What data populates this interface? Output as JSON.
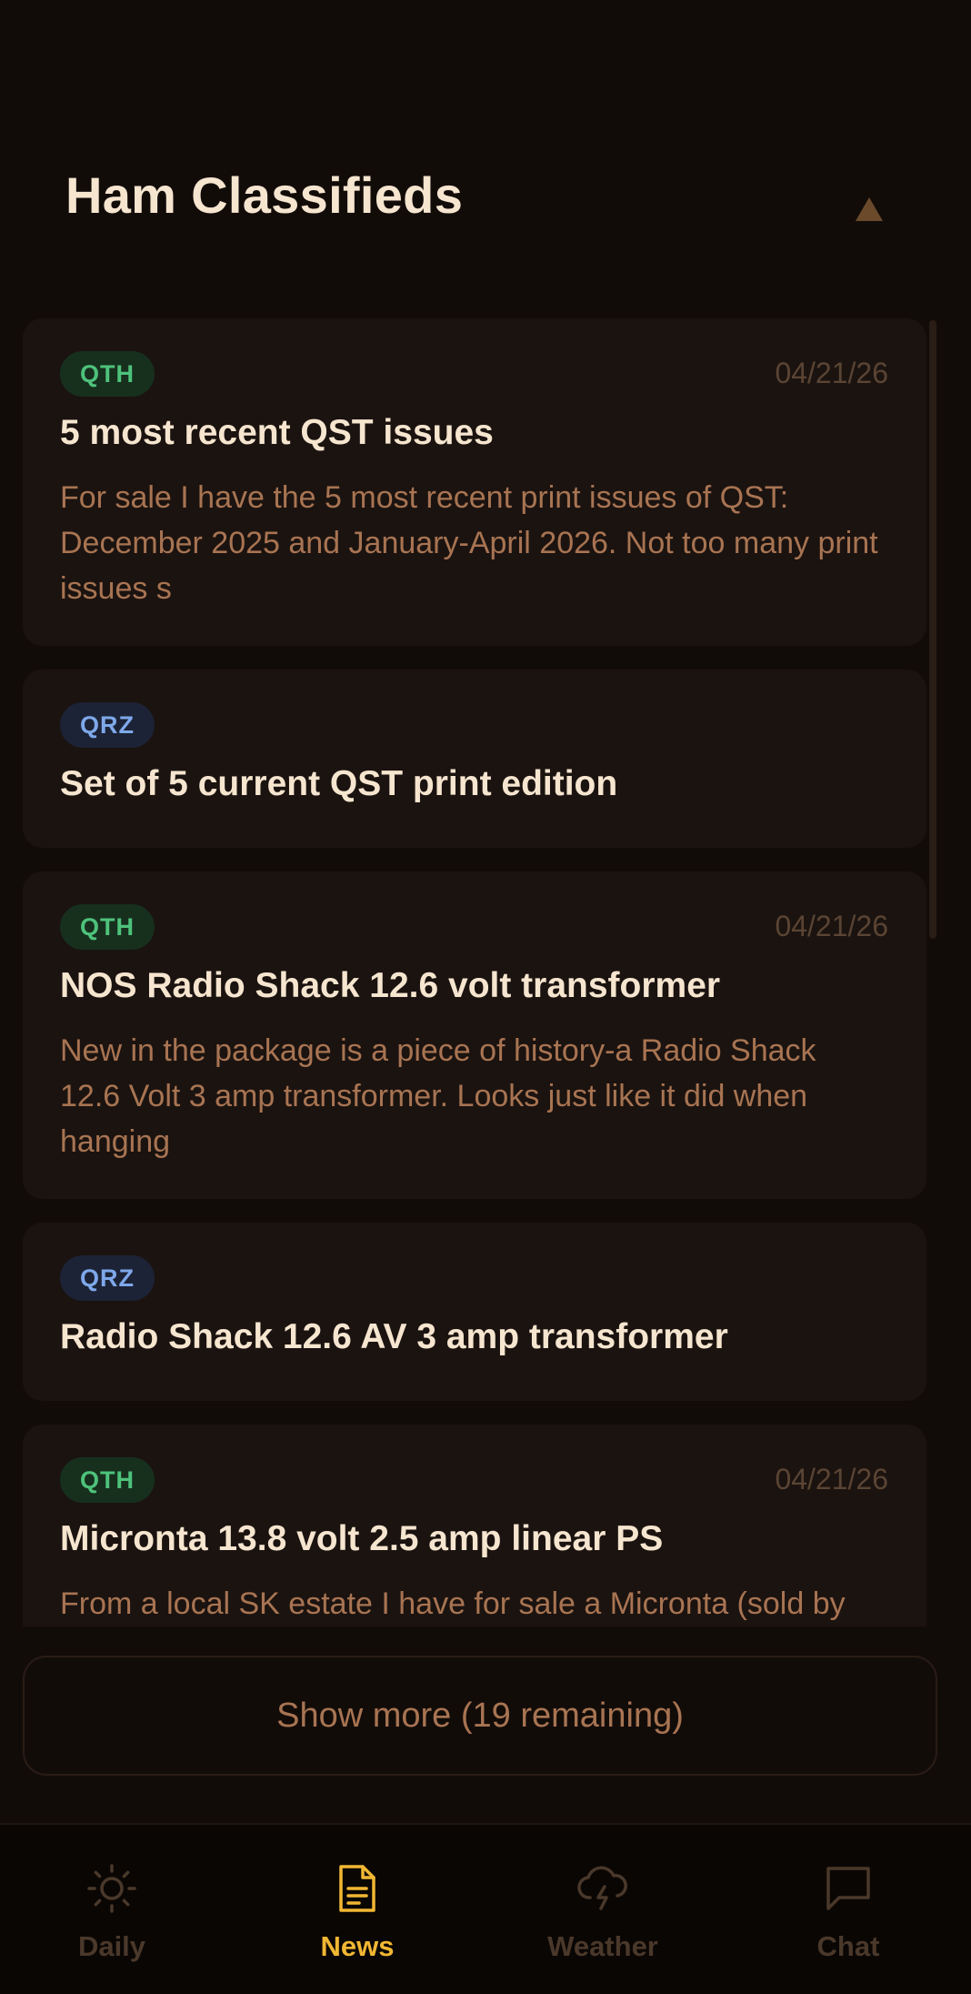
{
  "header": {
    "title": "Ham Classifieds",
    "collapse_icon": "triangle-up-icon"
  },
  "colors": {
    "background": "#120c09",
    "card": "#1b1310",
    "accent": "#f1b733",
    "title_text": "#f6e5cf",
    "snippet_text": "#a87452",
    "qth_badge": "#4ec27b",
    "qrz_badge": "#7ea8ea"
  },
  "listings": [
    {
      "source": "QTH",
      "date": "04/21/26",
      "title": "5 most recent QST issues",
      "snippet": "For sale I have the 5 most recent print issues of QST: December 2025 and January-April 2026. Not too many print issues s"
    },
    {
      "source": "QRZ",
      "date": "",
      "title": "Set of 5 current QST print edition",
      "snippet": ""
    },
    {
      "source": "QTH",
      "date": "04/21/26",
      "title": "NOS Radio Shack 12.6 volt transformer",
      "snippet": "New in the package is a piece of history-a Radio Shack 12.6 Volt 3 amp transformer. Looks just like it did when hanging"
    },
    {
      "source": "QRZ",
      "date": "",
      "title": "Radio Shack 12.6 AV 3 amp transformer",
      "snippet": ""
    },
    {
      "source": "QTH",
      "date": "04/21/26",
      "title": "Micronta 13.8 volt 2.5 amp linear PS",
      "snippet": "From a local SK estate I have for sale a Micronta (sold by"
    }
  ],
  "show_more": {
    "label": "Show more (19 remaining)"
  },
  "tabbar": {
    "active": "News",
    "tabs": [
      {
        "label": "Daily",
        "icon": "sun-icon"
      },
      {
        "label": "News",
        "icon": "document-icon"
      },
      {
        "label": "Weather",
        "icon": "storm-cloud-icon"
      },
      {
        "label": "Chat",
        "icon": "chat-bubble-icon"
      }
    ]
  }
}
